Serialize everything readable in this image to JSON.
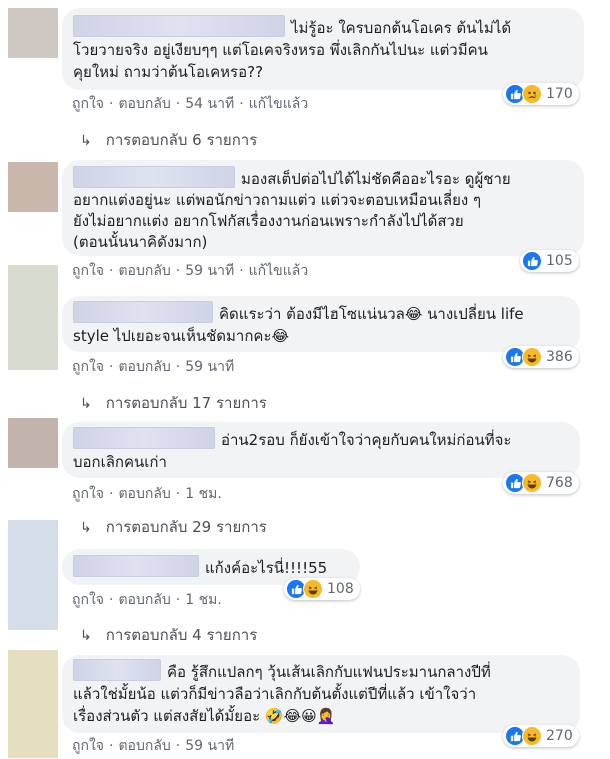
{
  "comments": [
    {
      "lines": [
        "ไม่รู้อะ ใครบอกต้นโอเคร ต้นไม่ได้",
        "โวยวายจริง อยู่เงียบๆๆ แต่โอเคจริงหรอ พึ่งเลิกกันไปนะ แต่วมีคน",
        "คุยใหม่ ถามว่าต้นโอเคหรอ??"
      ],
      "like": "ถูกใจ",
      "reply": "ตอบกลับ",
      "time": "54 นาที",
      "edited": "แก้ไขแล้ว",
      "reaction_count": "170",
      "reactions": [
        "like",
        "sad"
      ],
      "replies_label": "การตอบกลับ 6 รายการ"
    },
    {
      "lines": [
        "มองสเต็ปต่อไปได้ไม่ชัดคืออะไรอะ ดูผู้ชาย",
        "อยากแต่งอยู่นะ แต่พอนักข่าวถามแต่ว แต่วจะตอบเหมือนเลี่ยง ๆ",
        "ยังไม่อยากแต่ง อยากโฟกัสเรื่องงานก่อนเพราะกำลังไปได้สวย",
        "(ตอนนั้นนาคิดังมาก)"
      ],
      "like": "ถูกใจ",
      "reply": "ตอบกลับ",
      "time": "59 นาที",
      "edited": "แก้ไขแล้ว",
      "reaction_count": "105",
      "reactions": [
        "like"
      ]
    },
    {
      "lines": [
        "คิดแระว่า ต้องมีไฮโซแน่นวล😂 นางเปลี่ยน life",
        "style ไปเยอะจนเห็นชัดมากคะ😂"
      ],
      "like": "ถูกใจ",
      "reply": "ตอบกลับ",
      "time": "59 นาที",
      "reaction_count": "386",
      "reactions": [
        "like",
        "haha"
      ],
      "replies_label": "การตอบกลับ 17 รายการ"
    },
    {
      "lines": [
        "อ่าน2รอบ ก็ยังเข้าใจว่าคุยกับคนใหม่ก่อนที่จะ",
        "บอกเลิกคนเก่า"
      ],
      "like": "ถูกใจ",
      "reply": "ตอบกลับ",
      "time": "1 ชม.",
      "reaction_count": "768",
      "reactions": [
        "like",
        "haha"
      ],
      "replies_label": "การตอบกลับ 29 รายการ"
    },
    {
      "lines": [
        "แก้งค์อะไรนี่!!!!55"
      ],
      "like": "ถูกใจ",
      "reply": "ตอบกลับ",
      "time": "1 ชม.",
      "reaction_count": "108",
      "reactions": [
        "like",
        "haha"
      ],
      "replies_label": "การตอบกลับ 4 รายการ"
    },
    {
      "lines": [
        "คือ รู้สึกแปลกๆ วุ้นเส้นเลิกกับแฟนประมานกลางปีที่",
        "แล้วใช่มั้ยน้อ แต่วก็มีข่าวลือว่าเลิกกับต้นตั้งแต่ปีที่แล้ว เข้าใจว่า",
        "เรื่องส่วนตัว แต่สงสัยได้มั้ยอะ 🤣😂😀🤦‍♀️"
      ],
      "like": "ถูกใจ",
      "reply": "ตอบกลับ",
      "time": "59 นาที",
      "reaction_count": "270",
      "reactions": [
        "like",
        "haha"
      ]
    }
  ],
  "colors": {
    "like": "#1877f2",
    "haha": "#f7b928",
    "bubble": "#f2f3f5",
    "meta": "#606770"
  }
}
